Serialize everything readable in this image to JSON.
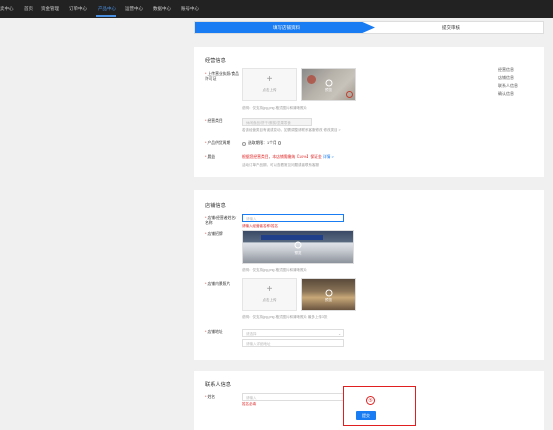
{
  "topnav": {
    "items": [
      "卖中心",
      "首页",
      "资金管理",
      "订单中心",
      "产品中心",
      "运营中心",
      "数据中心",
      "账号中心"
    ],
    "active_index": 4
  },
  "steps": {
    "step1": "填写店铺资料",
    "step2": "提交审核"
  },
  "business_info": {
    "title": "经营信息",
    "license_label": "上传营业执照/食品许可证",
    "upload_text": "点击上传",
    "preview_text": "预览",
    "license_note": "说明：仅支持jpg,png 格式图片和清晰照片",
    "category_label": "经营类目",
    "category_value": "休闲食品/饼干/蛋糕/坚果零食",
    "category_note": "若该经营类目有误或变动，如需调整请联系客服修改 修改类目 >",
    "category_link": "修改类目 >",
    "period_label": "产品供货周期",
    "period_option": "选取期限：1个月",
    "deposit_label": "晨益",
    "deposit_value": "根据您经营类目，本店铺需缴纳【10%】保证金",
    "deposit_link": "详情 >",
    "deposit_note": "活动订单产品期，可以查看常见问题或者联系客服"
  },
  "sidenav": [
    "经营信息",
    "店铺信息",
    "联系人信息",
    "确认信息"
  ],
  "store_info": {
    "title": "店铺信息",
    "name_label": "店铺/经营者姓名/名称",
    "name_placeholder": "请输入",
    "name_error": "请输入经营者名称/姓名",
    "front_label": "店铺招牌",
    "front_note": "说明：仅支持jpg,png 格式图片和清晰照片",
    "inside_label": "店铺内景照片",
    "upload_text": "点击上传",
    "preview_text": "预览",
    "inside_note": "说明：仅支持jpg,png 格式图片和清晰照片 最多上传3张",
    "address_label": "店铺地址",
    "address_select_placeholder": "请选择",
    "address_detail_placeholder": "请输入详细地址"
  },
  "contact_info": {
    "title": "联系人信息",
    "name_label": "姓名",
    "name_placeholder": "请输入",
    "name_error": "姓名必填"
  },
  "annotation": {
    "marker": "⑤"
  },
  "submit_label": "提交",
  "colors": {
    "accent": "#1a7cf2",
    "error": "#e02020",
    "topbar": "#222222"
  }
}
